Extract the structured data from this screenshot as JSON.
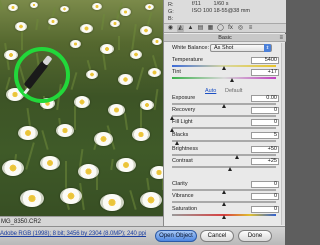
{
  "image": {
    "filename_partial": "MG_8350.CR2"
  },
  "histogram": {
    "rgb_labels": [
      "R:",
      "G:",
      "B:"
    ],
    "aperture": "f/11",
    "shutter": "1/60 s",
    "iso": "ISO 100",
    "lens": "18-55@38 mm"
  },
  "panel": {
    "section_title": "Basic",
    "white_balance_label": "White Balance:",
    "white_balance_value": "As Shot",
    "auto_label": "Auto",
    "default_label": "Default",
    "sliders": [
      {
        "label": "Temperature",
        "value": "5400",
        "level": 0.5
      },
      {
        "label": "Tint",
        "value": "+17",
        "level": 0.58
      },
      {
        "label": "Exposure",
        "value": "0.00",
        "level": 0.5
      },
      {
        "label": "Recovery",
        "value": "0",
        "level": 0.0
      },
      {
        "label": "Fill Light",
        "value": "0",
        "level": 0.0
      },
      {
        "label": "Blacks",
        "value": "5",
        "level": 0.05
      },
      {
        "label": "Brightness",
        "value": "+50",
        "level": 0.625
      },
      {
        "label": "Contrast",
        "value": "+25",
        "level": 0.56
      },
      {
        "label": "Clarity",
        "value": "0",
        "level": 0.5
      },
      {
        "label": "Vibrance",
        "value": "0",
        "level": 0.5
      },
      {
        "label": "Saturation",
        "value": "0",
        "level": 0.5
      }
    ]
  },
  "footer": {
    "info_link": "Adobe RGB (1998); 8 bit; 3456 by 2304 (8.0MP); 240 ppi",
    "open_object_label": "Open Object",
    "cancel_label": "Cancel",
    "done_label": "Done"
  },
  "colors": {
    "target_circle": "#22d83a",
    "accent_blue": "#4a7fd8"
  },
  "icons": [
    "zoom-icon",
    "hand-icon",
    "white-balance-icon",
    "color-sampler-icon",
    "target-adjust-icon",
    "crop-icon",
    "straighten-icon"
  ]
}
